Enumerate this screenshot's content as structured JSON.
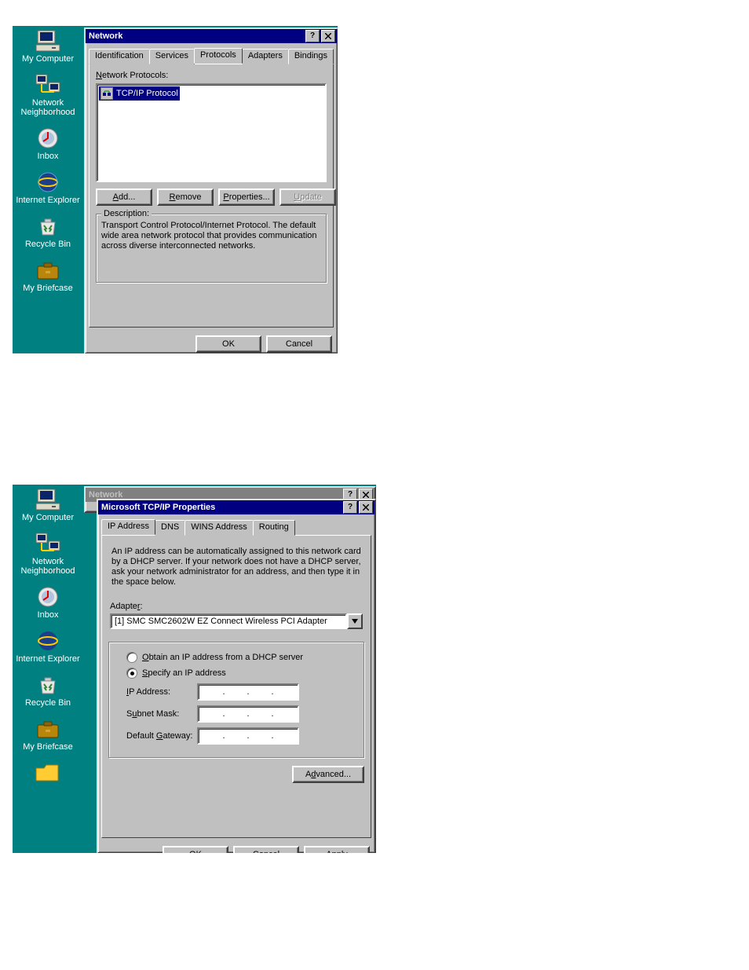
{
  "desktop": {
    "items": [
      {
        "label": "My Computer",
        "icon": "computer-icon"
      },
      {
        "label": "Network Neighborhood",
        "icon": "network-icon"
      },
      {
        "label": "Inbox",
        "icon": "inbox-icon"
      },
      {
        "label": "Internet Explorer",
        "icon": "ie-icon"
      },
      {
        "label": "Recycle Bin",
        "icon": "recycle-icon"
      },
      {
        "label": "My Briefcase",
        "icon": "briefcase-icon"
      }
    ]
  },
  "dlg1": {
    "title": "Network",
    "tabs": [
      "Identification",
      "Services",
      "Protocols",
      "Adapters",
      "Bindings"
    ],
    "active_tab": "Protocols",
    "list_label": "Network Protocols:",
    "list_items": [
      "TCP/IP Protocol"
    ],
    "buttons": {
      "add": "Add...",
      "remove": "Remove",
      "props": "Properties...",
      "update": "Update"
    },
    "desc_title": "Description:",
    "desc_text": "Transport Control Protocol/Internet Protocol. The default wide area network protocol that provides communication across diverse interconnected networks.",
    "ok": "OK",
    "cancel": "Cancel"
  },
  "dlg2bg": {
    "title": "Network"
  },
  "dlg2": {
    "title": "Microsoft TCP/IP Properties",
    "tabs": [
      "IP Address",
      "DNS",
      "WINS Address",
      "Routing"
    ],
    "active_tab": "IP Address",
    "intro": "An IP address can be automatically assigned to this network card by a DHCP server.  If your network does not have a DHCP server, ask your network administrator for an address, and then type it in the space below.",
    "adapter_label": "Adapter:",
    "adapter_value": "[1] SMC SMC2602W EZ Connect Wireless PCI Adapter",
    "radio_dhcp": "Obtain an IP address from a DHCP server",
    "radio_specify": "Specify an IP address",
    "ip_label": "IP Address:",
    "mask_label": "Subnet Mask:",
    "gw_label": "Default Gateway:",
    "advanced": "Advanced...",
    "ok": "OK",
    "cancel": "Cancel",
    "apply": "Apply"
  }
}
